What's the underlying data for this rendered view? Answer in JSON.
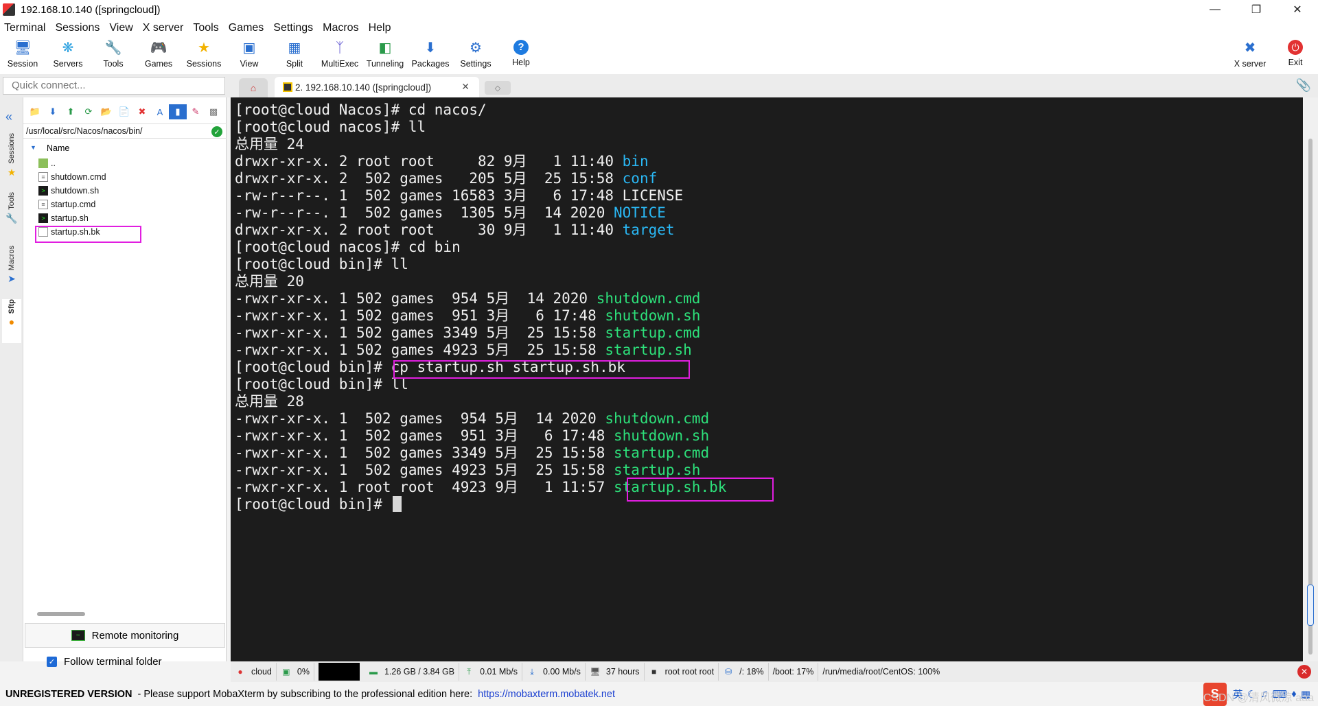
{
  "window": {
    "title": "192.168.10.140 ([springcloud])",
    "controls": [
      "minimize",
      "restore",
      "close"
    ]
  },
  "menubar": [
    "Terminal",
    "Sessions",
    "View",
    "X server",
    "Tools",
    "Games",
    "Settings",
    "Macros",
    "Help"
  ],
  "toolbar": {
    "buttons": [
      {
        "label": "Session",
        "icon": "monitor-icon"
      },
      {
        "label": "Servers",
        "icon": "servers-icon"
      },
      {
        "label": "Tools",
        "icon": "tools-icon"
      },
      {
        "label": "Games",
        "icon": "gamepad-icon"
      },
      {
        "label": "Sessions",
        "icon": "star-icon"
      },
      {
        "label": "View",
        "icon": "view-icon"
      },
      {
        "label": "Split",
        "icon": "split-icon"
      },
      {
        "label": "MultiExec",
        "icon": "multiexec-icon"
      },
      {
        "label": "Tunneling",
        "icon": "tunnel-icon"
      },
      {
        "label": "Packages",
        "icon": "package-icon"
      },
      {
        "label": "Settings",
        "icon": "gear-icon"
      },
      {
        "label": "Help",
        "icon": "help-icon"
      }
    ],
    "right": [
      {
        "label": "X server",
        "icon": "xserver-icon"
      },
      {
        "label": "Exit",
        "icon": "power-icon"
      }
    ]
  },
  "quick_connect": {
    "placeholder": "Quick connect..."
  },
  "tabs": {
    "active_tab": "2. 192.168.10.140 ([springcloud])"
  },
  "side_tabs": [
    "Sessions",
    "Tools",
    "Macros",
    "Sftp"
  ],
  "sftp": {
    "path": "/usr/local/src/Nacos/nacos/bin/",
    "column_header": "Name",
    "files": [
      {
        "name": "..",
        "type": "folder"
      },
      {
        "name": "shutdown.cmd",
        "type": "cmd"
      },
      {
        "name": "shutdown.sh",
        "type": "sh"
      },
      {
        "name": "startup.cmd",
        "type": "cmd"
      },
      {
        "name": "startup.sh",
        "type": "sh"
      },
      {
        "name": "startup.sh.bk",
        "type": "txt"
      }
    ],
    "remote_monitoring": "Remote monitoring",
    "follow_terminal_folder": "Follow terminal folder"
  },
  "terminal": {
    "lines": [
      [
        {
          "t": "[root@cloud Nacos]# cd nacos/"
        }
      ],
      [
        {
          "t": "[root@cloud nacos]# ll"
        }
      ],
      [
        {
          "t": "总用量 24"
        }
      ],
      [
        {
          "t": "drwxr-xr-x. 2 root root     82 9月   1 11:40 "
        },
        {
          "t": "bin",
          "c": "blue"
        }
      ],
      [
        {
          "t": "drwxr-xr-x. 2  502 games   205 5月  25 15:58 "
        },
        {
          "t": "conf",
          "c": "blue"
        }
      ],
      [
        {
          "t": "-rw-r--r--. 1  502 games 16583 3月   6 17:48 LICENSE"
        }
      ],
      [
        {
          "t": "-rw-r--r--. 1  502 games  1305 5月  14 2020 "
        },
        {
          "t": "NOTICE",
          "c": "blue"
        }
      ],
      [
        {
          "t": "drwxr-xr-x. 2 root root     30 9月   1 11:40 "
        },
        {
          "t": "target",
          "c": "blue"
        }
      ],
      [
        {
          "t": "[root@cloud nacos]# cd bin"
        }
      ],
      [
        {
          "t": "[root@cloud bin]# ll"
        }
      ],
      [
        {
          "t": "总用量 20"
        }
      ],
      [
        {
          "t": "-rwxr-xr-x. 1 502 games  954 5月  14 2020 "
        },
        {
          "t": "shutdown.cmd",
          "c": "green"
        }
      ],
      [
        {
          "t": "-rwxr-xr-x. 1 502 games  951 3月   6 17:48 "
        },
        {
          "t": "shutdown.sh",
          "c": "green"
        }
      ],
      [
        {
          "t": "-rwxr-xr-x. 1 502 games 3349 5月  25 15:58 "
        },
        {
          "t": "startup.cmd",
          "c": "green"
        }
      ],
      [
        {
          "t": "-rwxr-xr-x. 1 502 games 4923 5月  25 15:58 "
        },
        {
          "t": "startup.sh",
          "c": "green"
        }
      ],
      [
        {
          "t": "[root@cloud bin]# cp startup.sh startup.sh.bk"
        }
      ],
      [
        {
          "t": "[root@cloud bin]# ll"
        }
      ],
      [
        {
          "t": "总用量 28"
        }
      ],
      [
        {
          "t": "-rwxr-xr-x. 1  502 games  954 5月  14 2020 "
        },
        {
          "t": "shutdown.cmd",
          "c": "green"
        }
      ],
      [
        {
          "t": "-rwxr-xr-x. 1  502 games  951 3月   6 17:48 "
        },
        {
          "t": "shutdown.sh",
          "c": "green"
        }
      ],
      [
        {
          "t": "-rwxr-xr-x. 1  502 games 3349 5月  25 15:58 "
        },
        {
          "t": "startup.cmd",
          "c": "green"
        }
      ],
      [
        {
          "t": "-rwxr-xr-x. 1  502 games 4923 5月  25 15:58 "
        },
        {
          "t": "startup.sh",
          "c": "green"
        }
      ],
      [
        {
          "t": "-rwxr-xr-x. 1 root root  4923 9月   1 11:57 "
        },
        {
          "t": "startup.sh.bk",
          "c": "green"
        }
      ],
      [
        {
          "t": "[root@cloud bin]# "
        },
        {
          "cursor": true
        }
      ]
    ]
  },
  "statusbar": {
    "host": "cloud",
    "cpu": "0%",
    "memory": "1.26 GB / 3.84 GB",
    "upload": "0.01 Mb/s",
    "download": "0.00 Mb/s",
    "uptime": "37 hours",
    "users": "root  root  root",
    "disk_root": "/: 18%",
    "disk_boot": "/boot: 17%",
    "disk_media": "/run/media/root/CentOS: 100%"
  },
  "footer": {
    "unregistered": "UNREGISTERED VERSION",
    "message": "-  Please support MobaXterm by subscribing to the professional edition here:",
    "link": "https://mobaxterm.mobatek.net",
    "tray_logo": "S",
    "tray_lang": "英",
    "watermark": "CSDN @清风微凉 aaa"
  },
  "colors": {
    "terminal_bg": "#1c1c1c",
    "terminal_fg": "#f0f0f0",
    "dir_blue": "#2ab8f5",
    "exec_green": "#2de07a",
    "highlight_magenta": "#e11ee0"
  }
}
